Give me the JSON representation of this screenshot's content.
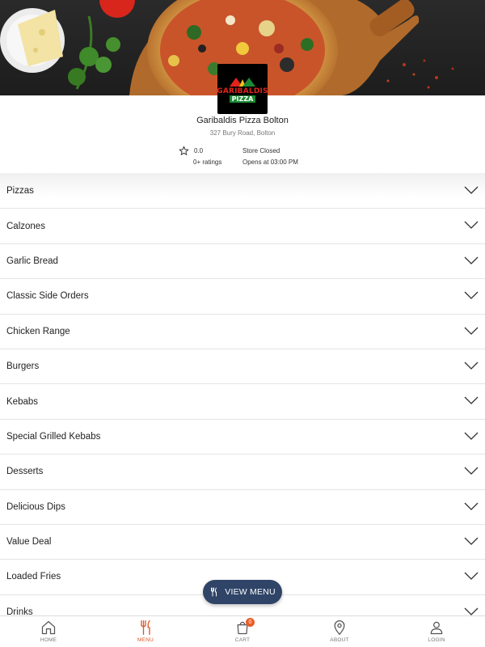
{
  "store": {
    "logo_text_top": "GARIBALDIS",
    "logo_text_bottom": "PIZZA",
    "name": "Garibaldis Pizza Bolton",
    "address": "327 Bury Road, Bolton",
    "rating": "0.0",
    "ratings_count": "0+ ratings",
    "status": "Store Closed",
    "opens": "Opens at 03:00 PM"
  },
  "categories": [
    "Pizzas",
    "Calzones",
    "Garlic Bread",
    "Classic Side Orders",
    "Chicken Range",
    "Burgers",
    "Kebabs",
    "Special Grilled Kebabs",
    "Desserts",
    "Delicious Dips",
    "Value Deal",
    "Loaded Fries",
    "Drinks"
  ],
  "view_menu": {
    "label": "VIEW MENU",
    "icon": "cutlery-icon"
  },
  "bottom_nav": {
    "items": [
      {
        "label": "HOME",
        "icon": "home-icon"
      },
      {
        "label": "MENU",
        "icon": "cutlery-icon"
      },
      {
        "label": "CART",
        "icon": "cart-icon",
        "badge": "0"
      },
      {
        "label": "ABOUT",
        "icon": "location-pin-icon"
      },
      {
        "label": "LOGIN",
        "icon": "user-icon"
      }
    ]
  },
  "colors": {
    "accent": "#d9572b",
    "badge": "#e85d2a",
    "view_menu_bg": "#2f4467",
    "logo_red": "#e2231a",
    "logo_green": "#1b8a34"
  }
}
